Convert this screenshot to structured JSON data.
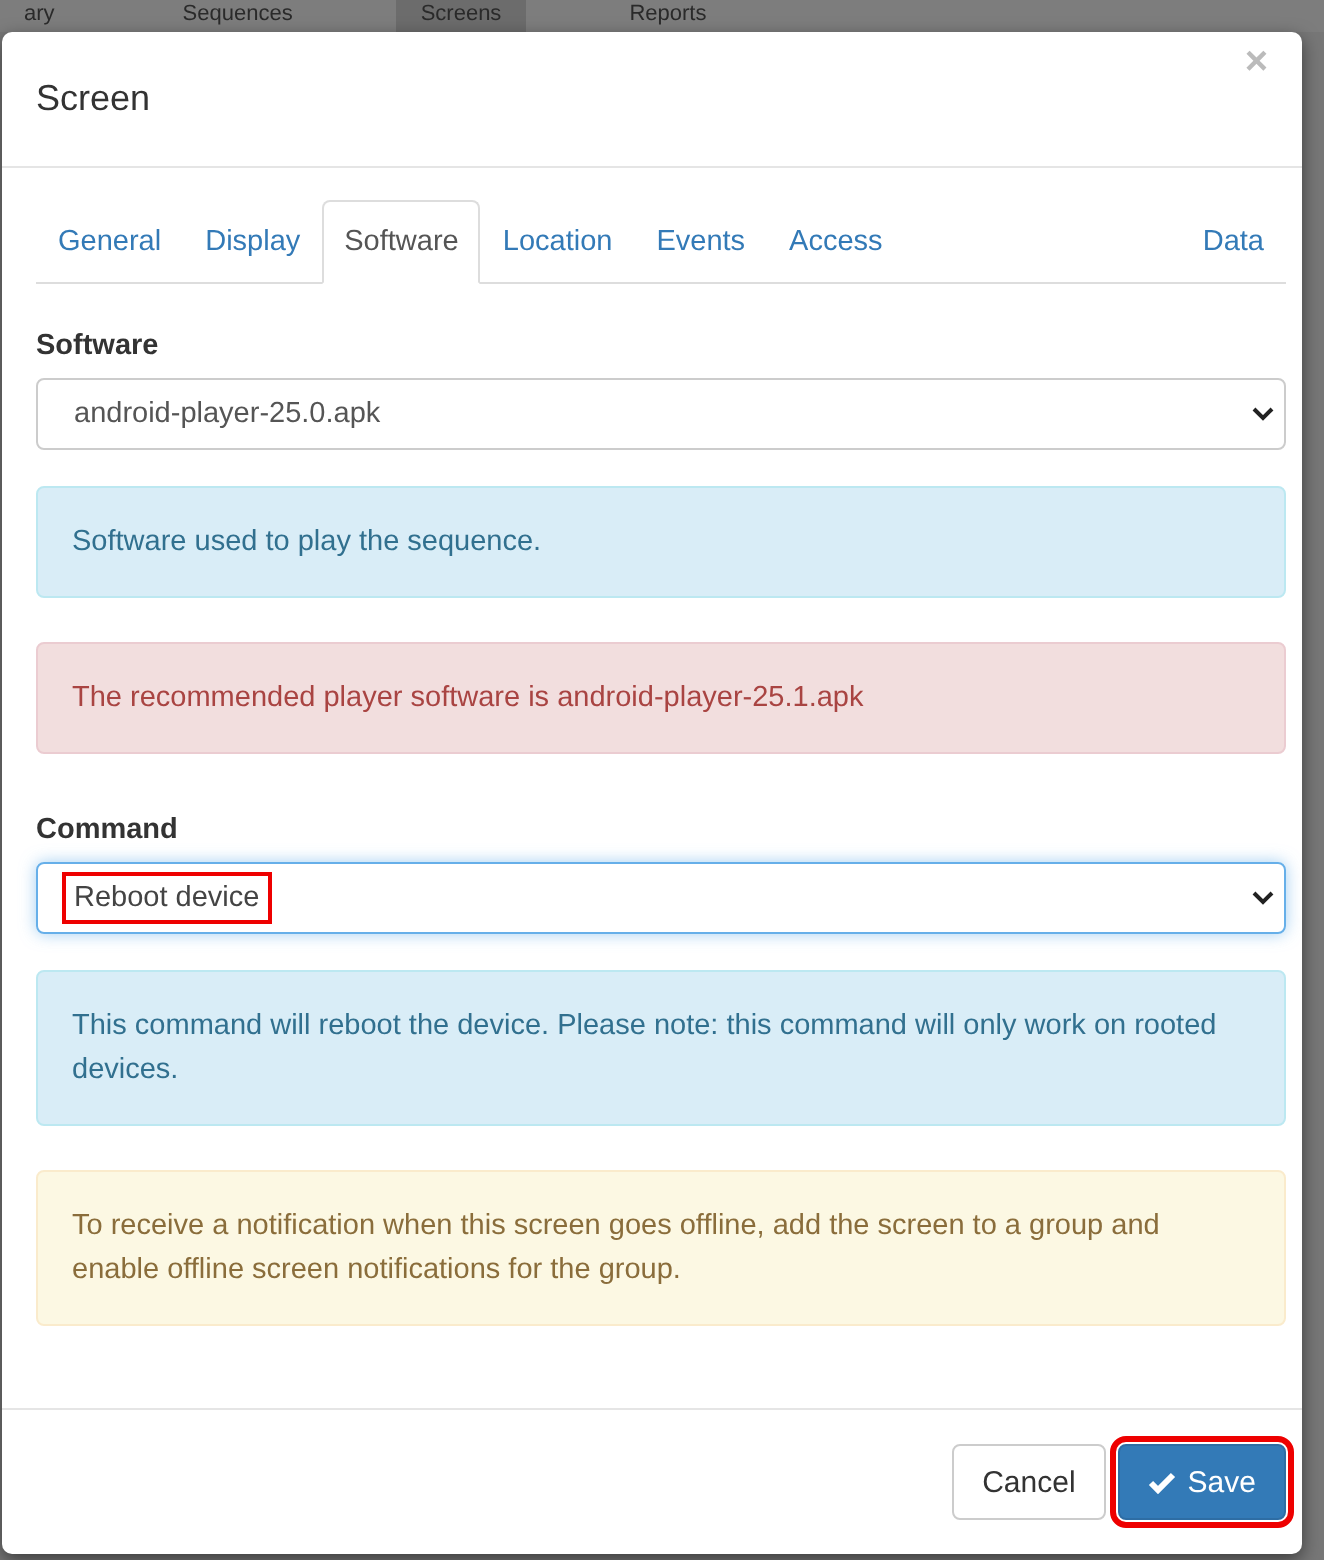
{
  "background_nav": [
    {
      "label": "ary",
      "selected": false
    },
    {
      "label": "Sequences",
      "selected": false
    },
    {
      "label": "Screens",
      "selected": true
    },
    {
      "label": "Reports",
      "selected": false
    }
  ],
  "dialog": {
    "title": "Screen",
    "close": "×"
  },
  "tabs": [
    {
      "label": "General",
      "selected": false
    },
    {
      "label": "Display",
      "selected": false
    },
    {
      "label": "Software",
      "selected": true
    },
    {
      "label": "Location",
      "selected": false
    },
    {
      "label": "Events",
      "selected": false
    },
    {
      "label": "Access",
      "selected": false
    },
    {
      "label": "Data",
      "selected": false
    }
  ],
  "software": {
    "label": "Software",
    "value": "android-player-25.0.apk",
    "highlighted": false
  },
  "alerts_1": [
    {
      "kind": "info",
      "text": "Software used to play the sequence."
    },
    {
      "kind": "danger",
      "text": "The recommended player software is android-player-25.1.apk"
    }
  ],
  "command": {
    "label": "Command",
    "value": "Reboot device",
    "highlighted": true
  },
  "alerts_2": [
    {
      "kind": "info",
      "text": "This command will reboot the device. Please note: this command will only work on rooted devices."
    },
    {
      "kind": "warning",
      "text": "To receive a notification when this screen goes offline, add the screen to a group and enable offline screen notifications for the group."
    }
  ],
  "buttons": [
    {
      "kind": "default",
      "label": "Cancel",
      "highlighted": false
    },
    {
      "kind": "primary",
      "label": "Save",
      "highlighted": true
    }
  ]
}
